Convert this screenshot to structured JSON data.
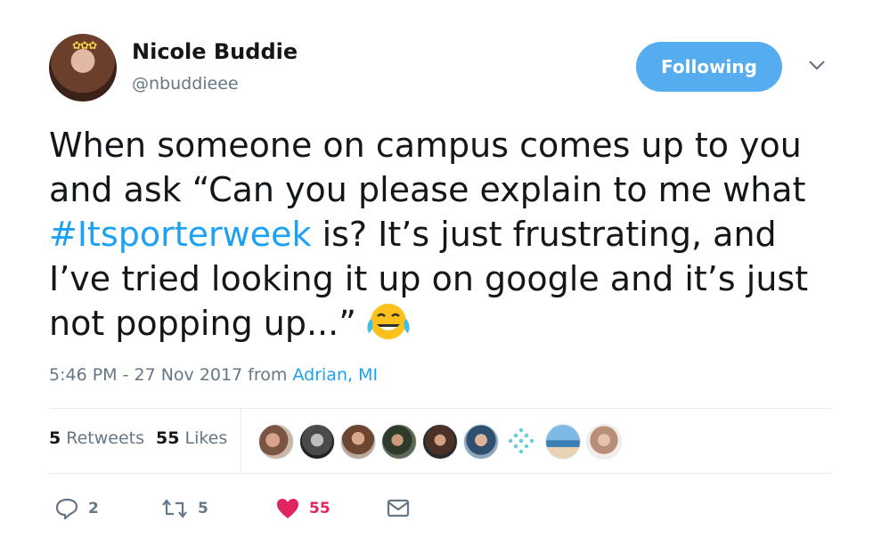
{
  "user": {
    "name": "Nicole Buddie",
    "handle": "@nbuddieee"
  },
  "follow": {
    "label": "Following",
    "color": "#55acee"
  },
  "tweet": {
    "line1": "When someone on campus comes up to you",
    "line2": "and ask “Can you please explain to me what",
    "hashtag": "#Itsporterweek",
    "line3_rest": " is? It’s just frustrating, and",
    "line4": "I’ve tried looking it up on google and it’s just",
    "line5": "not popping up...”",
    "emoji": "face-with-tears-of-joy-icon"
  },
  "meta": {
    "timestamp": "5:46 PM - 27 Nov 2017",
    "from_label": " from ",
    "location": "Adrian, MI"
  },
  "stats": {
    "retweets_count": "5",
    "retweets_label": " Retweets",
    "likes_count": "55",
    "likes_label": " Likes"
  },
  "actions": {
    "reply_count": "2",
    "retweet_count": "5",
    "like_count": "55"
  },
  "colors": {
    "link": "#1da1f2",
    "like": "#e0245e",
    "secondary": "#657786"
  }
}
